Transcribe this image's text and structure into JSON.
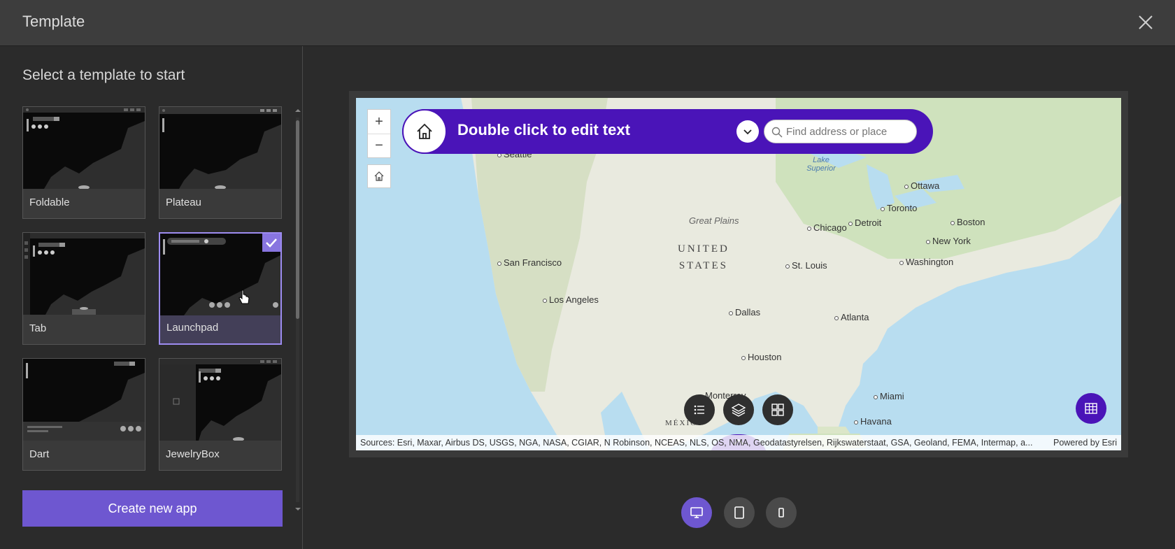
{
  "header": {
    "title": "Template"
  },
  "left": {
    "heading": "Select a template to start",
    "templates": [
      {
        "label": "Foldable",
        "selected": false
      },
      {
        "label": "Plateau",
        "selected": false
      },
      {
        "label": "Tab",
        "selected": false
      },
      {
        "label": "Launchpad",
        "selected": true
      },
      {
        "label": "Dart",
        "selected": false
      },
      {
        "label": "JewelryBox",
        "selected": false
      }
    ],
    "create_button": "Create new app"
  },
  "preview": {
    "banner_text": "Double click to edit text",
    "search_placeholder": "Find address or place",
    "zoom_in": "+",
    "zoom_out": "−",
    "cities": [
      "Seattle",
      "San Francisco",
      "Los Angeles",
      "Dallas",
      "Houston",
      "Monterrey",
      "St. Louis",
      "Chicago",
      "Detroit",
      "Toronto",
      "Ottawa",
      "Boston",
      "New York",
      "Washington",
      "Atlanta",
      "Miami",
      "Havana"
    ],
    "region_label_line1": "UNITED",
    "region_label_line2": "STATES",
    "plains_label": "Great Plains",
    "lake_label": "Lake Superior",
    "mexico_label": "MÉXICO",
    "attribution": "Sources: Esri, Maxar, Airbus DS, USGS, NGA, NASA, CGIAR, N Robinson, NCEAS, NLS, OS, NMA, Geodatastyrelsen, Rijkswaterstaat, GSA, Geoland, FEMA, Intermap, a...",
    "powered_by": "Powered by Esri",
    "accent_color": "#4a14b8"
  },
  "device_toggle": [
    "desktop",
    "tablet",
    "mobile"
  ],
  "colors": {
    "primary": "#6e57d0",
    "selected_border": "#9d8cf0"
  }
}
